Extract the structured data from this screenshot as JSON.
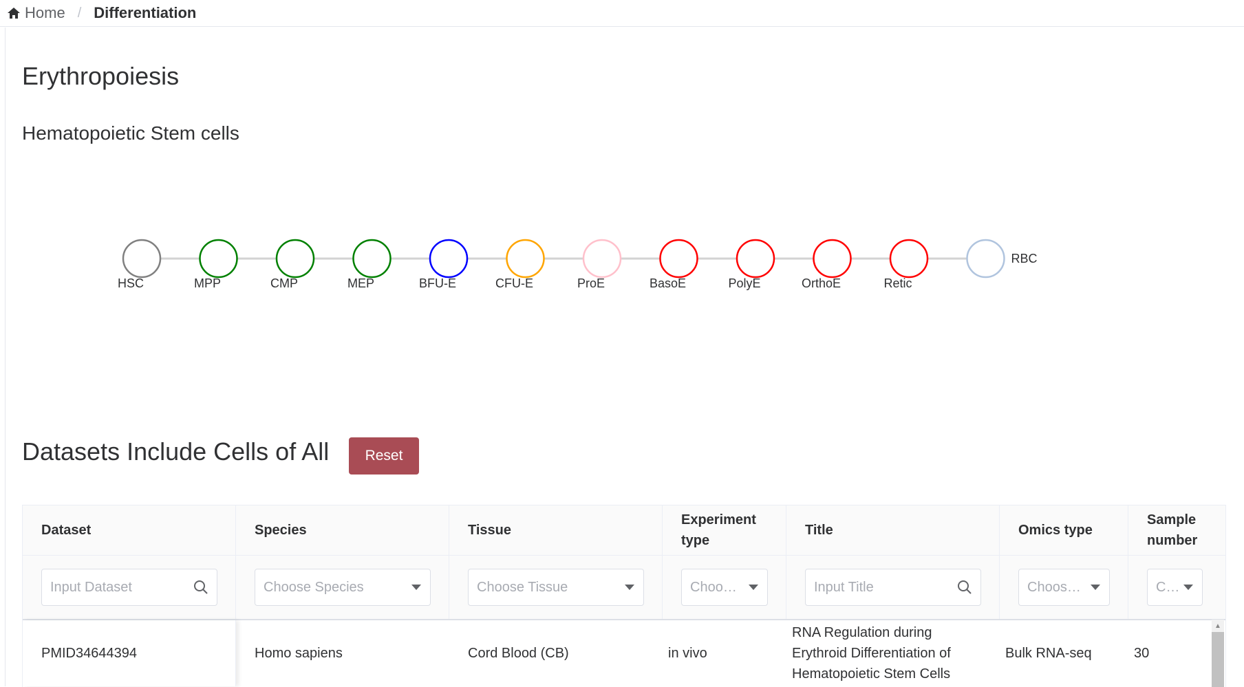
{
  "breadcrumb": {
    "home": "Home",
    "current": "Differentiation"
  },
  "title": "Erythropoiesis",
  "subtitle": "Hematopoietic Stem cells",
  "cells": [
    {
      "label": "HSC",
      "color": "#808080"
    },
    {
      "label": "MPP",
      "color": "#008000"
    },
    {
      "label": "CMP",
      "color": "#008000"
    },
    {
      "label": "MEP",
      "color": "#008000"
    },
    {
      "label": "BFU-E",
      "color": "#0000ff"
    },
    {
      "label": "CFU-E",
      "color": "#ffa500"
    },
    {
      "label": "ProE",
      "color": "#ffc0cb"
    },
    {
      "label": "BasoE",
      "color": "#ff0000"
    },
    {
      "label": "PolyE",
      "color": "#ff0000"
    },
    {
      "label": "OrthoE",
      "color": "#ff0000"
    },
    {
      "label": "Retic",
      "color": "#ff0000"
    },
    {
      "label": "RBC",
      "color": "#b0c4de"
    }
  ],
  "datasets_heading": "Datasets Include Cells of All",
  "reset_label": "Reset",
  "table": {
    "headers": {
      "dataset": "Dataset",
      "species": "Species",
      "tissue": "Tissue",
      "experiment_type": "Experiment type",
      "title": "Title",
      "omics_type": "Omics type",
      "sample_number": "Sample number"
    },
    "filters": {
      "dataset": "Input Dataset",
      "species": "Choose Species",
      "tissue": "Choose Tissue",
      "experiment_type": "Choo…",
      "title": "Input Title",
      "omics_type": "Choos…",
      "sample_number": "C…"
    },
    "rows": [
      {
        "dataset": "PMID34644394",
        "species": "Homo sapiens",
        "tissue": "Cord Blood (CB)",
        "experiment_type": "in vivo",
        "title": "RNA Regulation during Erythroid Differentiation of Hematopoietic Stem Cells",
        "omics_type": "Bulk RNA-seq",
        "sample_number": "30"
      }
    ]
  },
  "colors": {
    "accent": "#a94c55",
    "line": "#d3d3d3"
  }
}
